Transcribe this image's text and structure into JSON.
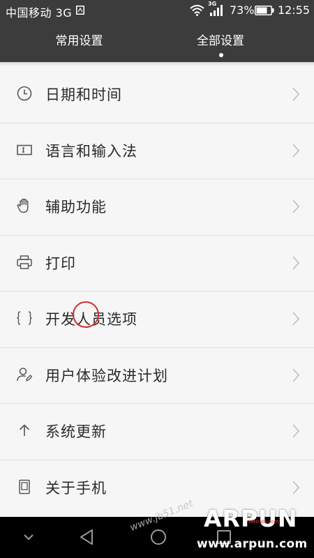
{
  "status_bar": {
    "carrier": "中国移动 3G",
    "battery_percent": "73%",
    "time": "12:55",
    "network_badge": "3G",
    "icons": [
      "sim-card-icon",
      "wifi-icon",
      "signal-icon",
      "battery-icon"
    ]
  },
  "tabs": [
    {
      "label": "常用设置",
      "active": false
    },
    {
      "label": "全部设置",
      "active": true
    }
  ],
  "settings_items": [
    {
      "label": "日期和时间",
      "icon": "clock-icon"
    },
    {
      "label": "语言和输入法",
      "icon": "keyboard-icon"
    },
    {
      "label": "辅助功能",
      "icon": "hand-icon"
    },
    {
      "label": "打印",
      "icon": "printer-icon"
    },
    {
      "label": "开发人员选项",
      "icon": "braces-icon"
    },
    {
      "label": "用户体验改进计划",
      "icon": "user-experience-icon"
    },
    {
      "label": "系统更新",
      "icon": "arrow-up-icon"
    },
    {
      "label": "关于手机",
      "icon": "phone-info-icon"
    }
  ],
  "nav_bar": {
    "icons": [
      "chevron-down-icon",
      "back-icon",
      "home-icon",
      "recent-apps-icon"
    ]
  },
  "watermarks": {
    "brand": "ARPUN",
    "brand_sub": "Web.do.com",
    "url": "www.arpun.com",
    "diagonal": "www.jb51.net"
  },
  "colors": {
    "header_bg": "#3c3c3c",
    "list_bg": "#f6f6f6",
    "divider": "#dedede",
    "annotation": "#d42a2a"
  }
}
